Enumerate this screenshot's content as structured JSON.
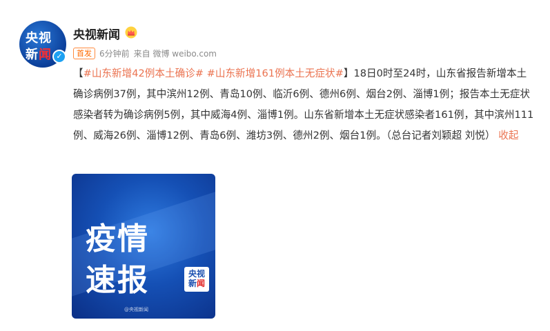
{
  "account": {
    "avatar_text_line1": "央视",
    "avatar_text_line2_a": "新",
    "avatar_text_line2_b": "闻",
    "verified_icon": "✓",
    "name": "央视新闻",
    "badge_icon": "crown-icon"
  },
  "meta": {
    "badge": "首发",
    "time": "6分钟前",
    "source": "来自 微博 weibo.com"
  },
  "post": {
    "open_bracket": "【",
    "tag1": "#山东新增42例本土确诊#",
    "space": " ",
    "tag2": "#山东新增161例本土无症状#",
    "close_bracket": "】",
    "body": "18日0时至24时，山东省报告新增本土确诊病例37例，其中滨州12例、青岛10例、临沂6例、德州6例、烟台2例、淄博1例；报告本土无症状感染者转为确诊病例5例，其中威海4例、淄博1例。山东省新增本土无症状感染者161例，其中滨州111例、威海26例、淄博12例、青岛6例、潍坊3例、德州2例、烟台1例。（总台记者刘颖超 刘悦）",
    "collapse": "收起"
  },
  "image": {
    "line1": "疫情",
    "line2": "速报",
    "logo_a": "央视",
    "logo_b1": "新",
    "logo_b2": "闻",
    "watermark": "@央视新闻"
  },
  "colors": {
    "link": "#eb7350",
    "accent_blue": "#1550b5"
  }
}
